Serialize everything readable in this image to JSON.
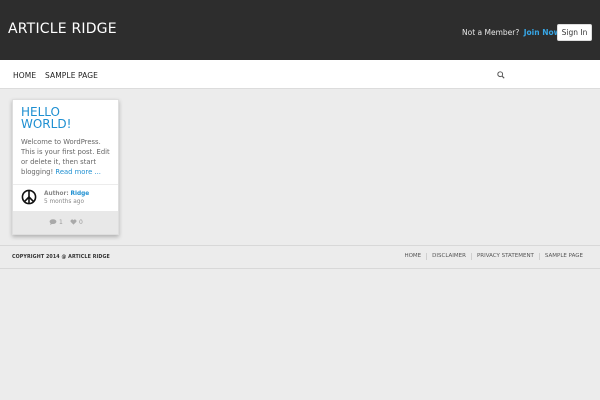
{
  "header": {
    "site_title": "ARTICLE RIDGE",
    "member_prompt": "Not a Member?",
    "join_label": "Join Now",
    "signin_label": "Sign In"
  },
  "nav": {
    "items": [
      {
        "label": "HOME"
      },
      {
        "label": "SAMPLE PAGE"
      }
    ],
    "search_icon": "search-icon"
  },
  "post": {
    "title": "HELLO WORLD!",
    "excerpt": "Welcome to WordPress. This is your first post. Edit or delete it, then start blogging!",
    "read_more": "Read more ...",
    "author_label": "Author:",
    "author_name": "Ridge",
    "time_ago": "5 months ago",
    "comments_count": "1",
    "likes_count": "0",
    "avatar_icon": "peace-sign-icon"
  },
  "footer": {
    "copyright": "COPYRIGHT 2014 @ ARTICLE RIDGE",
    "links": [
      {
        "label": "HOME"
      },
      {
        "label": "DISCLAIMER"
      },
      {
        "label": "PRIVACY STATEMENT"
      },
      {
        "label": "SAMPLE PAGE"
      }
    ]
  },
  "colors": {
    "header_bg": "#2d2d2d",
    "accent": "#1e8fd1",
    "join_link": "#37a6e6",
    "page_bg": "#ececec"
  }
}
